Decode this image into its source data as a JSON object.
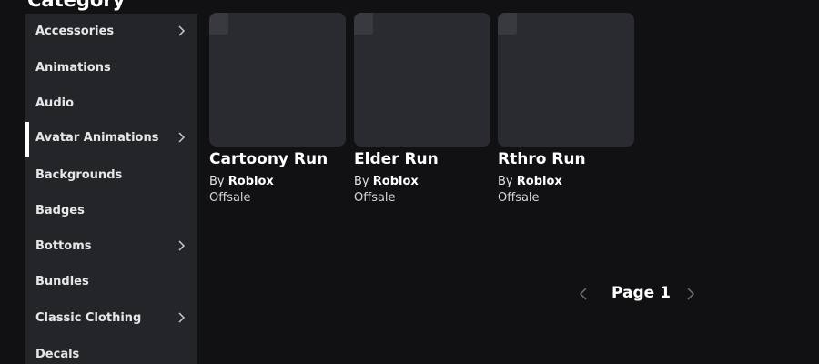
{
  "category": {
    "title": "Category"
  },
  "sidebar": {
    "items": [
      {
        "label": "Accessories",
        "has_submenu": true,
        "active": false
      },
      {
        "label": "Animations",
        "has_submenu": false,
        "active": false
      },
      {
        "label": "Audio",
        "has_submenu": false,
        "active": false
      },
      {
        "label": "Avatar Animations",
        "has_submenu": true,
        "active": true
      },
      {
        "label": "Backgrounds",
        "has_submenu": false,
        "active": false
      },
      {
        "label": "Badges",
        "has_submenu": false,
        "active": false
      },
      {
        "label": "Bottoms",
        "has_submenu": true,
        "active": false
      },
      {
        "label": "Bundles",
        "has_submenu": false,
        "active": false
      },
      {
        "label": "Classic Clothing",
        "has_submenu": true,
        "active": false
      },
      {
        "label": "Decals",
        "has_submenu": false,
        "active": false
      }
    ]
  },
  "items": [
    {
      "name": "Cartoony Run",
      "by_prefix": "By",
      "creator": "Roblox",
      "price": "Offsale"
    },
    {
      "name": "Elder Run",
      "by_prefix": "By",
      "creator": "Roblox",
      "price": "Offsale"
    },
    {
      "name": "Rthro Run",
      "by_prefix": "By",
      "creator": "Roblox",
      "price": "Offsale"
    }
  ],
  "pagination": {
    "label": "Page 1"
  },
  "colors": {
    "background": "#111113",
    "sidebar": "#232529",
    "thumbnail": "#2a2b30",
    "active_indicator": "#ffffff"
  },
  "icons": {
    "submenu": "chevron-right-icon",
    "prev": "chevron-left-icon",
    "next": "chevron-right-icon"
  }
}
